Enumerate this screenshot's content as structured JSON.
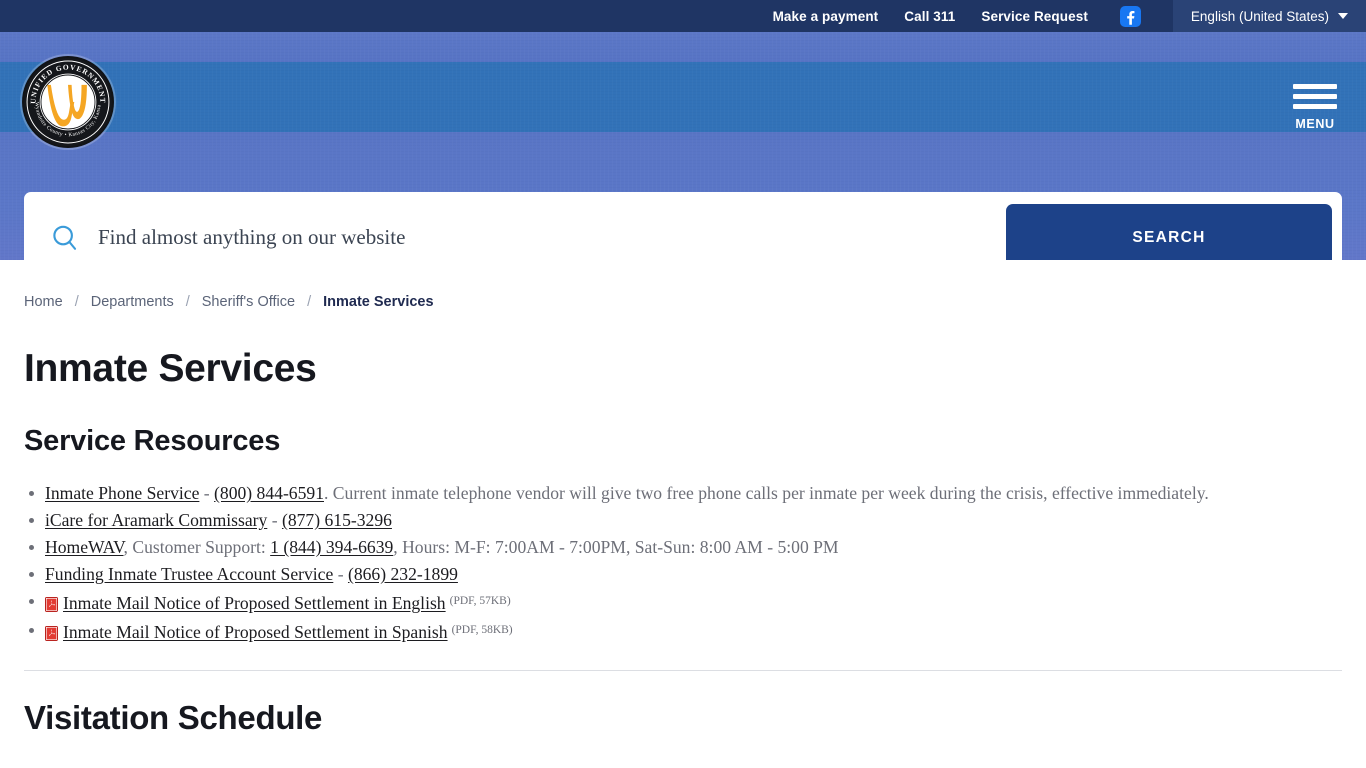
{
  "topbar": {
    "links": [
      {
        "label": "Make a payment",
        "name": "make-a-payment-link"
      },
      {
        "label": "Call 311",
        "name": "call-311-link"
      },
      {
        "label": "Service Request",
        "name": "service-request-link"
      }
    ],
    "social": {
      "icon": "facebook-icon",
      "color": "#1877F2"
    },
    "language": {
      "label": "English (United States)",
      "caret": "chevron-down-icon"
    },
    "background": "#1F3564"
  },
  "header": {
    "logo": {
      "outer_text": "UNIFIED GOVERNMENT",
      "inner_text": "Wyandotte County • Kansas City, Kansas",
      "mark": "W",
      "mark_color": "#F5A623"
    },
    "menu": {
      "label": "MENU",
      "icon": "hamburger-icon"
    },
    "band_colors": {
      "top": "#5572C4",
      "middle": "#3272B8",
      "bottom": "#5B77C8"
    }
  },
  "search": {
    "placeholder": "Find almost anything on our website",
    "value": "",
    "icon": "search-icon",
    "button_label": "SEARCH",
    "button_color": "#1D4289"
  },
  "breadcrumb": {
    "separator": "/",
    "items": [
      {
        "label": "Home",
        "current": false
      },
      {
        "label": "Departments",
        "current": false
      },
      {
        "label": "Sheriff's Office",
        "current": false
      },
      {
        "label": "Inmate Services",
        "current": true
      }
    ]
  },
  "main": {
    "page_title": "Inmate Services",
    "section_title": "Service Resources",
    "resources": [
      {
        "name": "inmate-phone-service-item",
        "parts": [
          {
            "type": "link",
            "text": "Inmate Phone Service"
          },
          {
            "type": "text",
            "text": " - "
          },
          {
            "type": "link",
            "text": "(800) 844-6591"
          },
          {
            "type": "text",
            "text": ". Current inmate telephone vendor will give two free phone calls per inmate per week during the crisis, effective immediately."
          }
        ]
      },
      {
        "name": "icare-aramark-commissary-item",
        "parts": [
          {
            "type": "link",
            "text": "iCare for Aramark Commissary"
          },
          {
            "type": "text",
            "text": " - "
          },
          {
            "type": "link",
            "text": "(877) 615-3296"
          }
        ]
      },
      {
        "name": "homewav-item",
        "parts": [
          {
            "type": "link",
            "text": "HomeWAV"
          },
          {
            "type": "text",
            "text": ", Customer Support: "
          },
          {
            "type": "link",
            "text": "1 (844) 394-6639"
          },
          {
            "type": "text",
            "text": ", Hours: M-F: 7:00AM - 7:00PM, Sat-Sun: 8:00 AM - 5:00 PM"
          }
        ]
      },
      {
        "name": "funding-inmate-trustee-account-item",
        "parts": [
          {
            "type": "link",
            "text": "Funding Inmate Trustee Account Service"
          },
          {
            "type": "text",
            "text": " - "
          },
          {
            "type": "link",
            "text": "(866) 232-1899"
          }
        ]
      },
      {
        "name": "inmate-mail-notice-english-item",
        "pdf": true,
        "parts": [
          {
            "type": "link",
            "text": "Inmate Mail Notice of Proposed Settlement in English"
          },
          {
            "type": "filesize",
            "text": "(PDF, 57KB)"
          }
        ]
      },
      {
        "name": "inmate-mail-notice-spanish-item",
        "pdf": true,
        "parts": [
          {
            "type": "link",
            "text": "Inmate Mail Notice of Proposed Settlement in Spanish"
          },
          {
            "type": "filesize",
            "text": "(PDF, 58KB)"
          }
        ]
      }
    ],
    "visitation_title": "Visitation Schedule"
  }
}
